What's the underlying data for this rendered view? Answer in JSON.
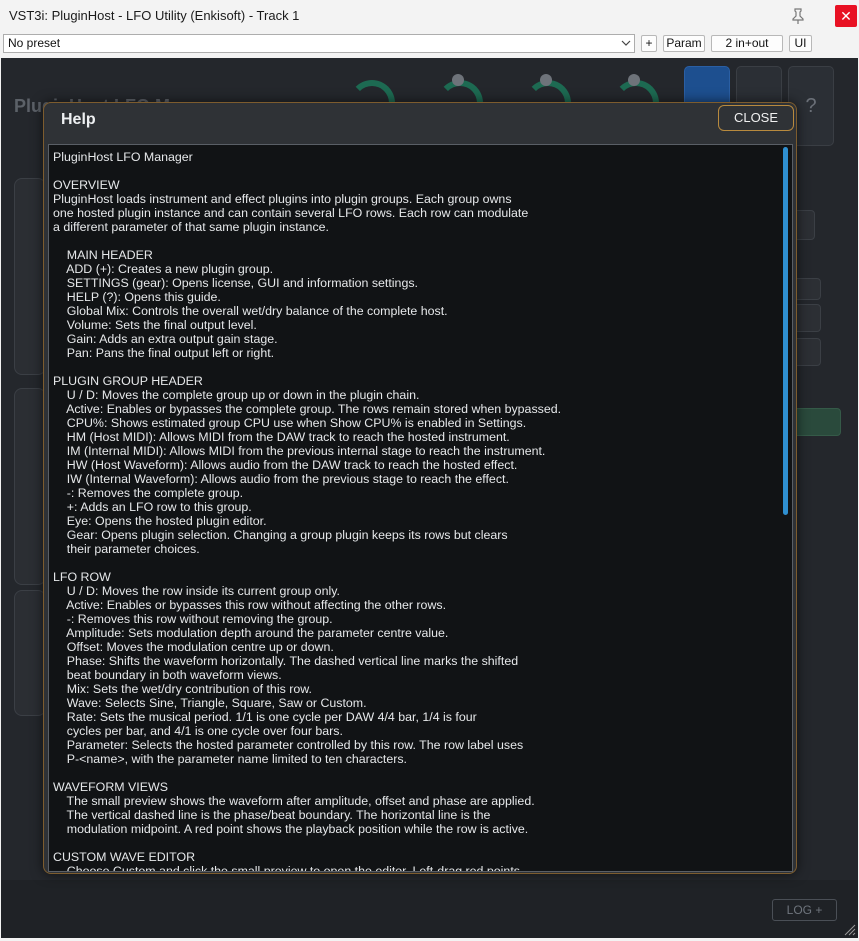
{
  "window": {
    "title": "VST3i: PluginHost - LFO Utility (Enkisoft) - Track 1",
    "close_glyph": "✕"
  },
  "toolbar": {
    "preset": "No preset",
    "add_label": "+",
    "param_label": "Param",
    "io_label": "2 in+out",
    "ui_label": "UI",
    "enabled_check": "✓"
  },
  "background": {
    "title": "PluginHost LFO Manager",
    "help_button": "?",
    "log_button": "LOG +"
  },
  "help": {
    "title": "Help",
    "close_label": "CLOSE",
    "text": "PluginHost LFO Manager\n\nOVERVIEW\nPluginHost loads instrument and effect plugins into plugin groups. Each group owns\none hosted plugin instance and can contain several LFO rows. Each row can modulate\na different parameter of that same plugin instance.\n\n    MAIN HEADER\n    ADD (+): Creates a new plugin group.\n    SETTINGS (gear): Opens license, GUI and information settings.\n    HELP (?): Opens this guide.\n    Global Mix: Controls the overall wet/dry balance of the complete host.\n    Volume: Sets the final output level.\n    Gain: Adds an extra output gain stage.\n    Pan: Pans the final output left or right.\n\nPLUGIN GROUP HEADER\n    U / D: Moves the complete group up or down in the plugin chain.\n    Active: Enables or bypasses the complete group. The rows remain stored when bypassed.\n    CPU%: Shows estimated group CPU use when Show CPU% is enabled in Settings.\n    HM (Host MIDI): Allows MIDI from the DAW track to reach the hosted instrument.\n    IM (Internal MIDI): Allows MIDI from the previous internal stage to reach the instrument.\n    HW (Host Waveform): Allows audio from the DAW track to reach the hosted effect.\n    IW (Internal Waveform): Allows audio from the previous stage to reach the effect.\n    -: Removes the complete group.\n    +: Adds an LFO row to this group.\n    Eye: Opens the hosted plugin editor.\n    Gear: Opens plugin selection. Changing a group plugin keeps its rows but clears\n    their parameter choices.\n\nLFO ROW\n    U / D: Moves the row inside its current group only.\n    Active: Enables or bypasses this row without affecting the other rows.\n    -: Removes this row without removing the group.\n    Amplitude: Sets modulation depth around the parameter centre value.\n    Offset: Moves the modulation centre up or down.\n    Phase: Shifts the waveform horizontally. The dashed vertical line marks the shifted\n    beat boundary in both waveform views.\n    Mix: Sets the wet/dry contribution of this row.\n    Wave: Selects Sine, Triangle, Square, Saw or Custom.\n    Rate: Sets the musical period. 1/1 is one cycle per DAW 4/4 bar, 1/4 is four\n    cycles per bar, and 4/1 is one cycle over four bars.\n    Parameter: Selects the hosted parameter controlled by this row. The row label uses\n    P-<name>, with the parameter name limited to ten characters.\n\nWAVEFORM VIEWS\n    The small preview shows the waveform after amplitude, offset and phase are applied.\n    The vertical dashed line is the phase/beat boundary. The horizontal line is the\n    modulation midpoint. A red point shows the playback position while the row is active.\n\nCUSTOM WAVE EDITOR\n    Choose Custom and click the small preview to open the editor. Left-drag red points"
  }
}
